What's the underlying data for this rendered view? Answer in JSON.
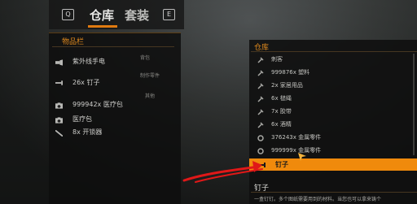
{
  "tabs": {
    "prev_key": "Q",
    "next_key": "E",
    "warehouse": "仓库",
    "outfit": "套装"
  },
  "left_panel": {
    "title": "物品栏",
    "sections": {
      "backpack": "背包",
      "craft_parts": "制作零件",
      "other": "其他"
    },
    "items": [
      {
        "label": "紫外线手电",
        "icon": "flashlight-icon"
      },
      {
        "label": "26x 钉子",
        "icon": "nail-icon"
      },
      {
        "label": "999942x 医疗包",
        "icon": "medkit-icon"
      },
      {
        "label": "医疗包",
        "icon": "medkit-icon"
      },
      {
        "label": "8x 开锁器",
        "icon": "lockpick-icon"
      }
    ]
  },
  "right_panel": {
    "title": "仓库",
    "items": [
      {
        "label": "刺客",
        "icon": "wrench-icon"
      },
      {
        "label": "999876x 塑料",
        "icon": "wrench-icon"
      },
      {
        "label": "2x 家居用品",
        "icon": "wrench-icon"
      },
      {
        "label": "6x 槌绳",
        "icon": "wrench-icon"
      },
      {
        "label": "7x 胶带",
        "icon": "wrench-icon"
      },
      {
        "label": "6x 酒精",
        "icon": "wrench-icon"
      },
      {
        "label": "376243x 金属零件",
        "icon": "gear-icon"
      },
      {
        "label": "999999x 金属零件",
        "icon": "gear-icon"
      }
    ],
    "selected": "钉子"
  },
  "detail": {
    "title": "钉子",
    "description": "一盒钉钉。多个图纸需要用到的材料。当您也可以拿来铸个"
  },
  "colors": {
    "accent": "#f08a0c",
    "panel_title": "#e08a1e",
    "annotation_red": "#e01818"
  }
}
